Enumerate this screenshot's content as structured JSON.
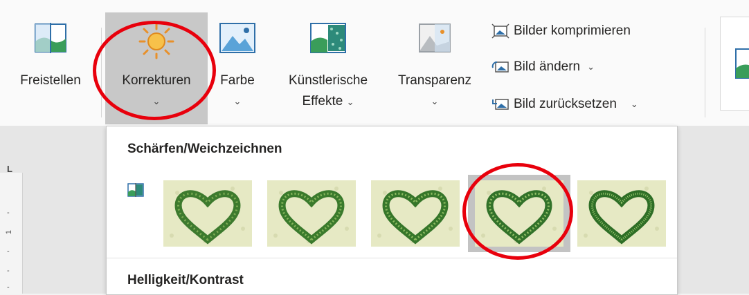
{
  "ribbon": {
    "freistellen_label": "Freistellen",
    "korrekturen_label": "Korrekturen",
    "farbe_label": "Farbe",
    "kuenstlerische_label_1": "Künstlerische",
    "kuenstlerische_label_2": "Effekte",
    "transparenz_label": "Transparenz",
    "bilder_komprimieren_label": "Bilder komprimieren",
    "bild_aendern_label": "Bild ändern",
    "bild_zuruecksetzen_label": "Bild zurücksetzen",
    "chevron": "⌄"
  },
  "dropdown": {
    "section1_title": "Schärfen/Weichzeichnen",
    "section2_title": "Helligkeit/Kontrast",
    "thumbnails": [
      {
        "name": "sharpen-thumb-1"
      },
      {
        "name": "sharpen-thumb-2"
      },
      {
        "name": "sharpen-thumb-3"
      },
      {
        "name": "sharpen-thumb-4",
        "selected": true
      },
      {
        "name": "sharpen-thumb-5"
      }
    ]
  },
  "ruler": {
    "corner": "L",
    "mark": "1"
  },
  "colors": {
    "highlight_circle": "#e8000c",
    "selected_bg": "#c8c8c8"
  }
}
